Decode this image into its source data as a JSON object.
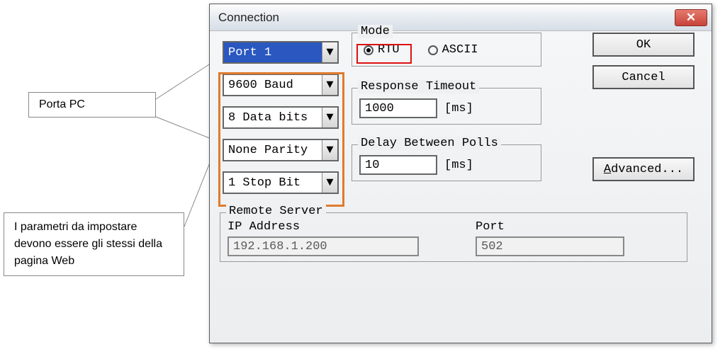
{
  "dialog": {
    "title": "Connection"
  },
  "toolbar": {
    "ok_label": "OK",
    "cancel_label": "Cancel",
    "advanced_label": "dvanced..."
  },
  "serial": {
    "port": "Port 1",
    "baud": "9600 Baud",
    "databits": "8 Data bits",
    "parity": "None Parity",
    "stopbit": "1 Stop Bit"
  },
  "mode": {
    "legend": "Mode",
    "rtu_label": "RTU",
    "ascii_label": "ASCII",
    "selected": "RTU"
  },
  "response": {
    "legend": "Response Timeout",
    "value": "1000",
    "unit": "[ms]"
  },
  "delay": {
    "legend": "Delay Between Polls",
    "value": "10",
    "unit": "[ms]"
  },
  "remote": {
    "legend": "Remote Server",
    "ip_label": "IP Address",
    "ip_value": "192.168.1.200",
    "port_label": "Port",
    "port_value": "502"
  },
  "annotations": {
    "porta_pc": "Porta PC",
    "params": "I parametri da impostare devono essere gli stessi della pagina Web"
  }
}
